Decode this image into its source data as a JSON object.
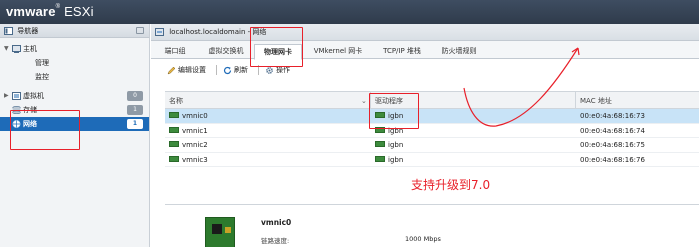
{
  "app": {
    "brand": "vmware",
    "product": "ESXi",
    "registered": "®"
  },
  "navigator": {
    "title": "导航器",
    "items": [
      {
        "label": "主机",
        "expanded": true
      },
      {
        "label": "管理"
      },
      {
        "label": "监控"
      },
      {
        "label": "虚拟机",
        "badge": "0"
      },
      {
        "label": "存储",
        "badge": "1"
      },
      {
        "label": "网络",
        "badge": "1",
        "selected": true
      }
    ]
  },
  "breadcrumb": "localhost.localdomain - 网络",
  "tabs": [
    {
      "label": "端口组"
    },
    {
      "label": "虚拟交换机"
    },
    {
      "label": "物理网卡",
      "active": true
    },
    {
      "label": "VMkernel 网卡"
    },
    {
      "label": "TCP/IP 堆栈"
    },
    {
      "label": "防火墙规则"
    }
  ],
  "toolbar": {
    "edit": "编辑设置",
    "refresh": "刷新",
    "actions": "操作"
  },
  "table": {
    "columns": [
      "名称",
      "驱动程序",
      "MAC 地址"
    ],
    "rows": [
      {
        "name": "vmnic0",
        "driver": "igbn",
        "mac": "00:e0:4a:68:16:73",
        "selected": true
      },
      {
        "name": "vmnic1",
        "driver": "igbn",
        "mac": "00:e0:4a:68:16:74"
      },
      {
        "name": "vmnic2",
        "driver": "igbn",
        "mac": "00:e0:4a:68:16:75"
      },
      {
        "name": "vmnic3",
        "driver": "igbn",
        "mac": "00:e0:4a:68:16:76"
      }
    ]
  },
  "detail": {
    "title": "vmnic0",
    "speed_label": "链路速度:",
    "speed_value": "1000 Mbps"
  },
  "annotation": {
    "text": "支持升级到7.0"
  },
  "colors": {
    "topbar": "#34404f",
    "selection": "#1e6bb8",
    "row_selected": "#c8e3f7",
    "annotation": "#e8202a"
  }
}
